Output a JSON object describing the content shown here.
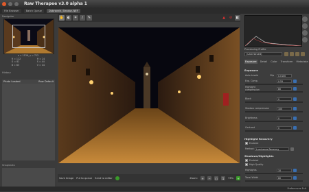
{
  "window": {
    "title": "Raw Therapee v3.0 alpha 1"
  },
  "tabs": [
    {
      "label": "File Browser"
    },
    {
      "label": "Batch Queue"
    },
    {
      "label": "Dubrovnik_Stradun-NEF"
    }
  ],
  "left": {
    "navigator_label": "Navigator",
    "coords": {
      "xy": "x = 1139, y = 712",
      "rgb": [
        "R = 112",
        "G = 82",
        "B = 63"
      ],
      "hsv": [
        "H = 24",
        "S = 44",
        "V = 44"
      ]
    },
    "history_label": "History",
    "profile_label": "Photo Loaded",
    "profile_value": "Raw Default",
    "snapshots_label": "Snapshots",
    "snapshot_add": "Add",
    "snapshot_del": "Del"
  },
  "toolbar": {
    "icons": [
      "hand-tool-icon",
      "white-balance-icon",
      "crop-icon",
      "straighten-icon",
      "color-picker-icon"
    ]
  },
  "bottombar": {
    "save_image": "Save Image",
    "put_queue": "Put to queue",
    "send_editor": "Send to editor",
    "zoom_label": "Zoom:",
    "zoom_value": "73%"
  },
  "right": {
    "profile_label": "Processing Profile",
    "profile_value": "(Last Saved)",
    "tabs": [
      "Exposure",
      "Detail",
      "Color",
      "Transform",
      "Metadata"
    ],
    "exposure": {
      "title": "Exposure",
      "auto": "Auto Levels",
      "clip_label": "Clip",
      "clip_value": "0.0100",
      "rows": [
        {
          "label": "Exp. Comp.",
          "value": "0.55"
        },
        {
          "label": "Highlight compression",
          "value": "80"
        },
        {
          "label": "Black",
          "value": "0"
        },
        {
          "label": "Shadow compression",
          "value": "100"
        },
        {
          "label": "Brightness",
          "value": "0"
        },
        {
          "label": "Contrast",
          "value": "0"
        }
      ]
    },
    "highlight_recovery": {
      "title": "Highlight Recovery",
      "enabled": "Enabled",
      "method_label": "Method:",
      "method_value": "Luminance Recovery"
    },
    "shadows_highlights": {
      "title": "Shadows/Highlights",
      "enabled": "Enabled",
      "hq": "High Quality",
      "highlights_label": "Highlights",
      "highlights_value": "10",
      "tonal_label": "Tonal Width",
      "tonal_value": "80"
    }
  },
  "statusbar": {
    "text": "Preferences   Exit"
  }
}
